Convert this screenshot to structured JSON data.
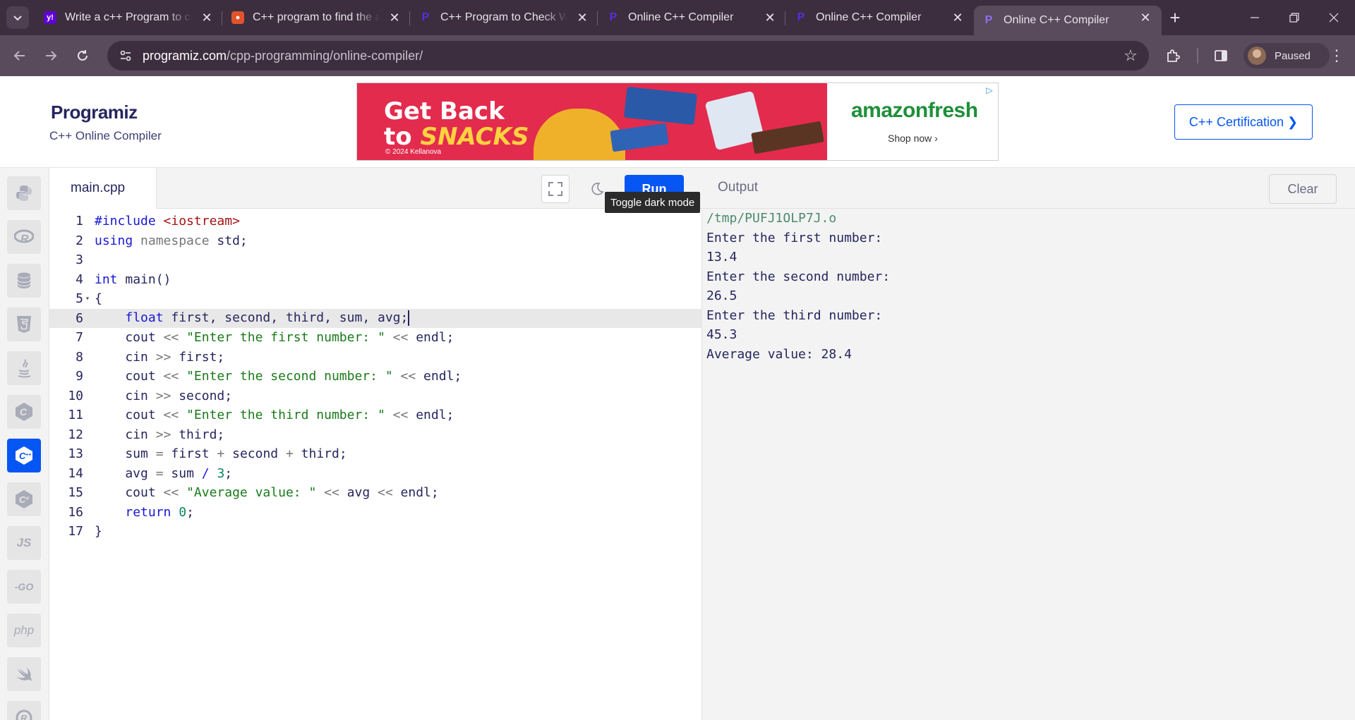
{
  "browser": {
    "tabs": [
      {
        "title": "Write a c++ Program to co",
        "icon": "yahoo-icon",
        "color": "#6001d2"
      },
      {
        "title": "C++ program to find the a",
        "icon": "prepinsta-icon",
        "color": "#e2532b"
      },
      {
        "title": "C++ Program to Check Wh",
        "icon": "programiz-icon",
        "color": "#5b2be0"
      },
      {
        "title": "Online C++ Compiler",
        "icon": "programiz-icon",
        "color": "#5b2be0"
      },
      {
        "title": "Online C++ Compiler",
        "icon": "programiz-icon",
        "color": "#5b2be0"
      },
      {
        "title": "Online C++ Compiler",
        "icon": "programiz-icon",
        "color": "#5b2be0"
      }
    ],
    "url_host": "programiz.com",
    "url_path": "/cpp-programming/online-compiler/",
    "profile_status": "Paused"
  },
  "header": {
    "logo": "Programiz",
    "subtitle": "C++ Online Compiler",
    "certification_button": "C++ Certification ❯"
  },
  "ad": {
    "headline_line1": "Get Back",
    "headline_to": "to ",
    "headline_snacks": "SNACKS",
    "copyright": "© 2024 Kellanova",
    "brand": "amazonfresh",
    "cta": "Shop now ›"
  },
  "languages": [
    "python",
    "r",
    "sql",
    "html",
    "java",
    "c",
    "cpp",
    "csharp",
    "js",
    "go",
    "php",
    "swift",
    "rust"
  ],
  "language_labels": {
    "js": "JS",
    "go": "-GO",
    "php": "php"
  },
  "editor": {
    "filename": "main.cpp",
    "run_label": "Run",
    "tooltip": "Toggle dark mode",
    "line_numbers": [
      "1",
      "2",
      "3",
      "4",
      "5",
      "6",
      "7",
      "8",
      "9",
      "10",
      "11",
      "12",
      "13",
      "14",
      "15",
      "16",
      "17"
    ]
  },
  "output": {
    "title": "Output",
    "clear_label": "Clear",
    "lines": [
      "/tmp/PUFJ1OLP7J.o",
      "Enter the first number:",
      "13.4",
      "Enter the second number:",
      "26.5",
      "Enter the third number:",
      "45.3",
      "Average value: 28.4"
    ]
  },
  "colors": {
    "accent": "#0556f3",
    "chrome_dark": "#3c2e3e",
    "chrome_toolbar": "#594a5c"
  }
}
